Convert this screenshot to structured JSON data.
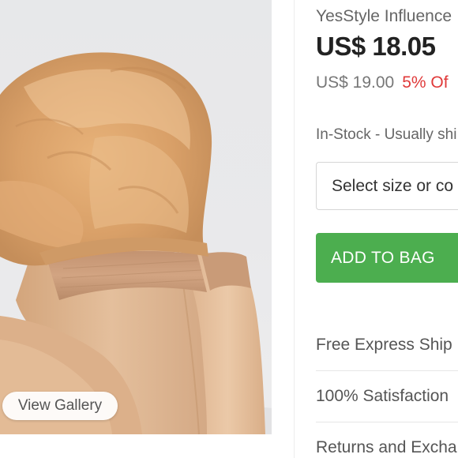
{
  "gallery": {
    "view_gallery_label": "View Gallery"
  },
  "product": {
    "brand": "YesStyle Influence",
    "price": "US$ 18.05",
    "original_price": "US$ 19.00",
    "discount": "5% Of",
    "stock_status": "In-Stock - Usually shi",
    "select_placeholder": "Select size or co",
    "add_to_bag_label": "ADD TO BAG"
  },
  "features": [
    {
      "label": "Free Express Ship"
    },
    {
      "label": "100% Satisfaction"
    },
    {
      "label": "Returns and Excha"
    }
  ],
  "colors": {
    "accent_green": "#4cae4f",
    "discount_red": "#e03a3a"
  }
}
